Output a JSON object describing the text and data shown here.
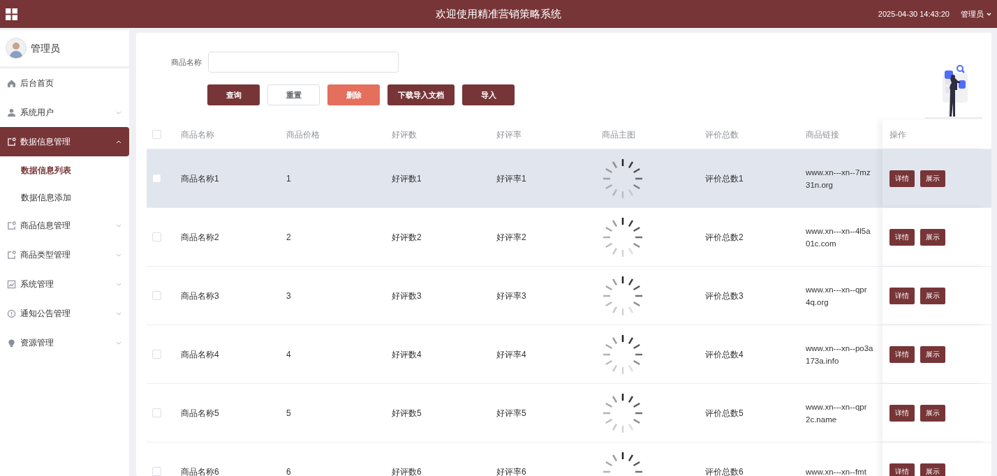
{
  "topbar": {
    "title": "欢迎使用精准营销策略系统",
    "datetime": "2025-04-30 14:43:20",
    "user": "管理员"
  },
  "sidebar": {
    "user": "管理员",
    "items": [
      {
        "label": "后台首页",
        "expandable": false,
        "expanded": false,
        "selected": false
      },
      {
        "label": "系统用户",
        "expandable": true,
        "expanded": false,
        "selected": false
      },
      {
        "label": "数据信息管理",
        "expandable": true,
        "expanded": true,
        "selected": true,
        "children": [
          {
            "label": "数据信息列表",
            "selected": true
          },
          {
            "label": "数据信息添加",
            "selected": false
          }
        ]
      },
      {
        "label": "商品信息管理",
        "expandable": true,
        "expanded": false,
        "selected": false
      },
      {
        "label": "商品类型管理",
        "expandable": true,
        "expanded": false,
        "selected": false
      },
      {
        "label": "系统管理",
        "expandable": true,
        "expanded": false,
        "selected": false
      },
      {
        "label": "通知公告管理",
        "expandable": true,
        "expanded": false,
        "selected": false
      },
      {
        "label": "资源管理",
        "expandable": true,
        "expanded": false,
        "selected": false
      }
    ]
  },
  "search": {
    "label": "商品名称"
  },
  "buttons": [
    {
      "label": "查询",
      "kind": "primary"
    },
    {
      "label": "重置",
      "kind": "plain"
    },
    {
      "label": "删除",
      "kind": "danger"
    },
    {
      "label": "下载导入文档",
      "kind": "primary"
    },
    {
      "label": "导入",
      "kind": "primary"
    }
  ],
  "table": {
    "all_checked": false,
    "columns": [
      "商品名称",
      "商品价格",
      "好评数",
      "好评率",
      "商品主图",
      "评价总数",
      "商品链接",
      "操作"
    ],
    "rows": [
      {
        "checked": false,
        "hovered": true,
        "name": "商品名称1",
        "price": "1",
        "good_count": "好评数1",
        "good_rate": "好评率1",
        "total": "评价总数1",
        "link_lines": [
          "www.xn---xn--7mz",
          "31n.org"
        ],
        "actions": [
          "详情",
          "展示"
        ]
      },
      {
        "checked": false,
        "hovered": false,
        "name": "商品名称2",
        "price": "2",
        "good_count": "好评数2",
        "good_rate": "好评率2",
        "total": "评价总数2",
        "link_lines": [
          "www.xn---xn--4l5a",
          "01c.com"
        ],
        "actions": [
          "详情",
          "展示"
        ]
      },
      {
        "checked": false,
        "hovered": false,
        "name": "商品名称3",
        "price": "3",
        "good_count": "好评数3",
        "good_rate": "好评率3",
        "total": "评价总数3",
        "link_lines": [
          "www.xn---xn--qpr",
          "4q.org"
        ],
        "actions": [
          "详情",
          "展示"
        ]
      },
      {
        "checked": false,
        "hovered": false,
        "name": "商品名称4",
        "price": "4",
        "good_count": "好评数4",
        "good_rate": "好评率4",
        "total": "评价总数4",
        "link_lines": [
          "www.xn---xn--po3a",
          "173a.info"
        ],
        "actions": [
          "详情",
          "展示"
        ]
      },
      {
        "checked": false,
        "hovered": false,
        "name": "商品名称5",
        "price": "5",
        "good_count": "好评数5",
        "good_rate": "好评率5",
        "total": "评价总数5",
        "link_lines": [
          "www.xn---xn--qpr",
          "2c.name"
        ],
        "actions": [
          "详情",
          "展示"
        ]
      },
      {
        "checked": false,
        "hovered": false,
        "name": "商品名称6",
        "price": "6",
        "good_count": "好评数6",
        "good_rate": "好评率6",
        "total": "评价总数6",
        "link_lines": [
          "www.xn---xn--fmt"
        ],
        "actions": [
          "详情",
          "展示"
        ]
      }
    ]
  }
}
